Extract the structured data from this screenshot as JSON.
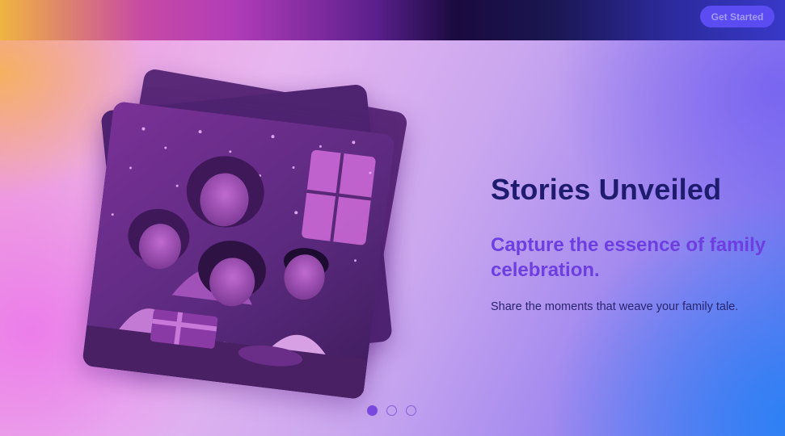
{
  "header": {
    "cta_label": "Get Started"
  },
  "hero": {
    "title": "Stories Unveiled",
    "subtitle": "Capture the essence of family celebration.",
    "body": "Share the moments that weave your family tale.",
    "illustration_icon": "family-celebration-illustration"
  },
  "carousel": {
    "count": 3,
    "active_index": 0
  },
  "colors": {
    "title": "#1f1b6e",
    "subtitle": "#6e3fe0",
    "button": "#5a4cf0",
    "active_dot": "#7a48dc"
  }
}
